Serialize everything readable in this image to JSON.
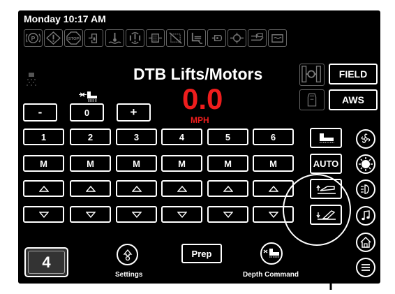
{
  "header": {
    "datetime": "Monday 10:17 AM"
  },
  "indicators": [
    "parking-brake-icon",
    "warning-icon",
    "stop-icon",
    "fuel-filter-icon",
    "coolant-temp-icon",
    "hydraulic-alert-icon",
    "hydraulic-filter-icon",
    "no-regen-icon",
    "seat-icon",
    "oil-pressure-icon",
    "engine-icon",
    "air-filter-icon",
    "battery-icon"
  ],
  "main": {
    "title": "DTB Lifts/Motors",
    "speed": "0.0",
    "speed_unit": "MPH"
  },
  "right_top": {
    "field_label": "FIELD",
    "aws_label": "AWS"
  },
  "stepper": {
    "minus": "-",
    "value": "0",
    "plus": "+"
  },
  "rows": {
    "numbers": [
      "1",
      "2",
      "3",
      "4",
      "5",
      "6"
    ],
    "modes": [
      "M",
      "M",
      "M",
      "M",
      "M",
      "M"
    ]
  },
  "side": {
    "auto_label": "AUTO"
  },
  "bottom": {
    "page_number": "4",
    "settings_label": "Settings",
    "prep_label": "Prep",
    "depth_label": "Depth Command"
  },
  "colors": {
    "background": "#000000",
    "speed": "#ee1d1d",
    "text": "#ffffff",
    "dim": "#777777"
  }
}
